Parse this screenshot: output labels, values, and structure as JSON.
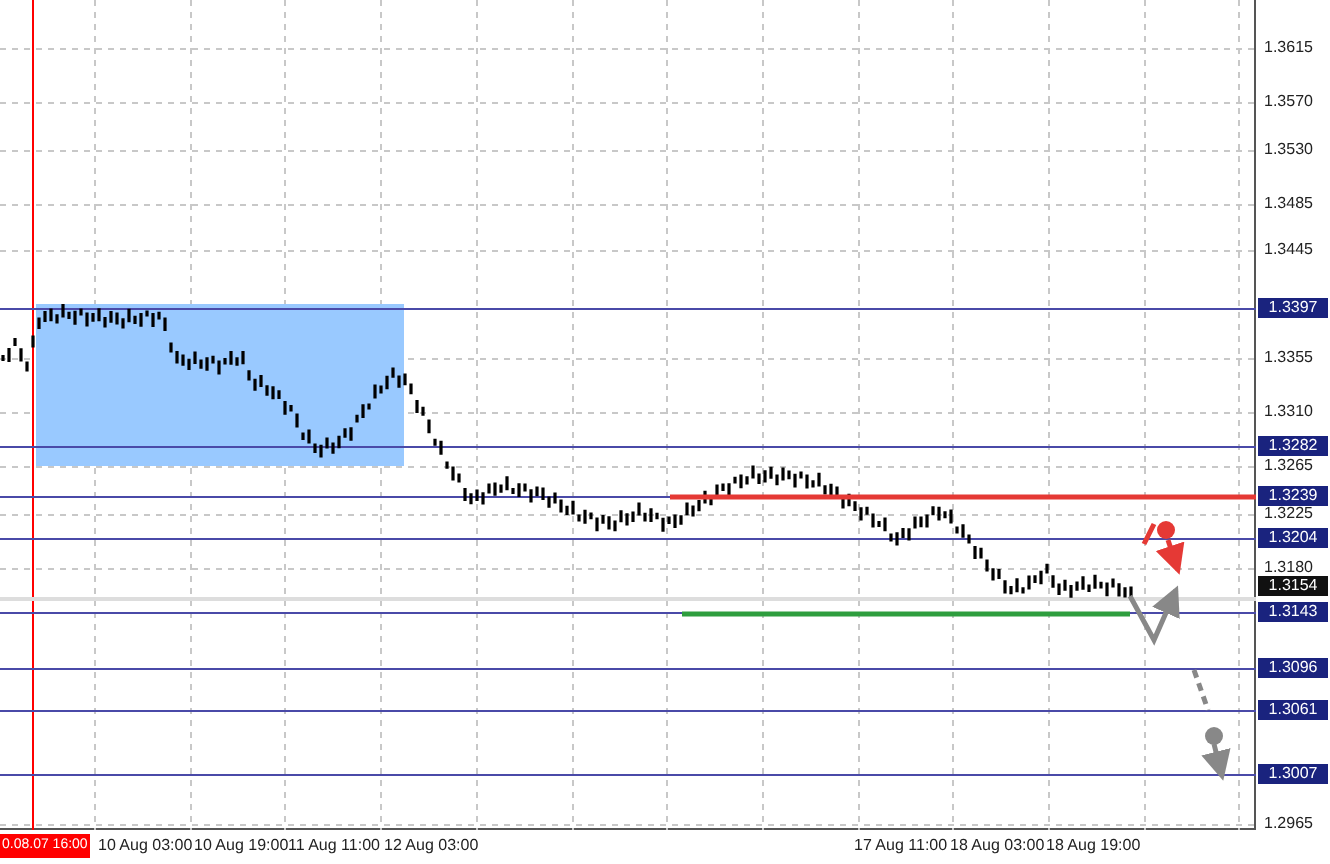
{
  "price_axis": {
    "labels": [
      "1.3615",
      "1.3570",
      "1.3530",
      "1.3485",
      "1.3445",
      "1.3355",
      "1.3310",
      "1.3265",
      "1.3225",
      "1.3180",
      "1.2965"
    ]
  },
  "levels": [
    {
      "price": "1.3397"
    },
    {
      "price": "1.3282"
    },
    {
      "price": "1.3239"
    },
    {
      "price": "1.3204"
    },
    {
      "price": "1.3143"
    },
    {
      "price": "1.3096"
    },
    {
      "price": "1.3061"
    },
    {
      "price": "1.3007"
    }
  ],
  "current_price": {
    "label": "1.3154"
  },
  "time_axis": {
    "marker": "0.08.07 16:00",
    "labels": [
      "10 Aug 03:00",
      "10 Aug 19:00",
      "11 Aug 11:00",
      "12 Aug 03:00",
      "17 Aug 11:00",
      "18 Aug 03:00",
      "18 Aug 19:00"
    ]
  }
}
